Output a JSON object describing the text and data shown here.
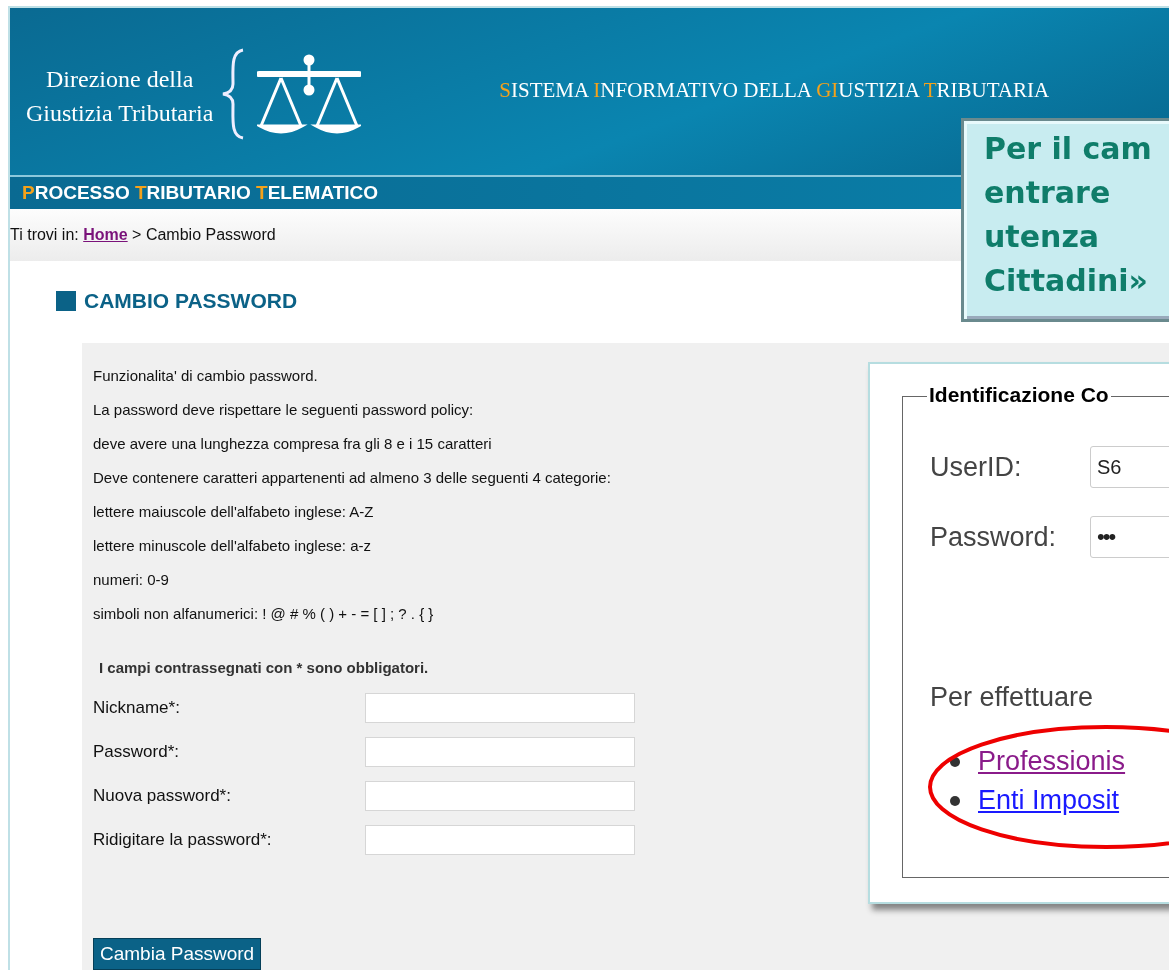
{
  "header": {
    "org_name_lines": [
      "Direzione della",
      "Giustizia Tributaria"
    ],
    "system_title": [
      {
        "accent": "S",
        "text": "ISTEMA"
      },
      {
        "accent": "I",
        "text": "NFORMATIVO"
      },
      {
        "text": "DELLA"
      },
      {
        "accent": "GI",
        "text": "USTIZIA"
      },
      {
        "accent": "T",
        "text": "RIBUTARIA"
      }
    ],
    "subtitle": [
      {
        "accent": "P",
        "text": "ROCESSO"
      },
      {
        "accent": "T",
        "text": "RIBUTARIO"
      },
      {
        "accent": "T",
        "text": "ELEMATICO"
      }
    ]
  },
  "breadcrumb": {
    "prefix": "Ti trovi in:",
    "link": "Home",
    "current": "> Cambio Password"
  },
  "page_title": "CAMBIO PASSWORD",
  "info_lines": [
    "Funzionalita' di cambio password.",
    "La password deve rispettare le seguenti password policy:",
    "deve avere una lunghezza compresa fra gli 8 e i 15 caratteri",
    "Deve contenere caratteri appartenenti ad almeno 3 delle seguenti 4 categorie:",
    "lettere maiuscole dell'alfabeto inglese: A-Z",
    "lettere minuscole dell'alfabeto inglese: a-z",
    "numeri: 0-9",
    "simboli non alfanumerici: ! @ # % ( ) + - = [ ] ; ? . { }"
  ],
  "required_note": "I campi contrassegnati con * sono obbligatori.",
  "fields": [
    {
      "label": "Nickname*:"
    },
    {
      "label": "Password*:"
    },
    {
      "label": "Nuova password*:"
    },
    {
      "label": "Ridigitare la password*:"
    }
  ],
  "submit_button": "Cambia Password",
  "login_box": {
    "legend": "Identificazione Co",
    "fields": [
      {
        "label": "UserID:",
        "value": "S6"
      },
      {
        "label": "Password:",
        "value": "•••"
      }
    ],
    "intro": "Per effettuare",
    "links": [
      {
        "text": "Professionis",
        "visited": true
      },
      {
        "text": "Enti Imposit",
        "visited": false
      }
    ]
  },
  "callout_lines": [
    "Per il cam",
    "entrare",
    "utenza",
    "Cittadini»"
  ]
}
